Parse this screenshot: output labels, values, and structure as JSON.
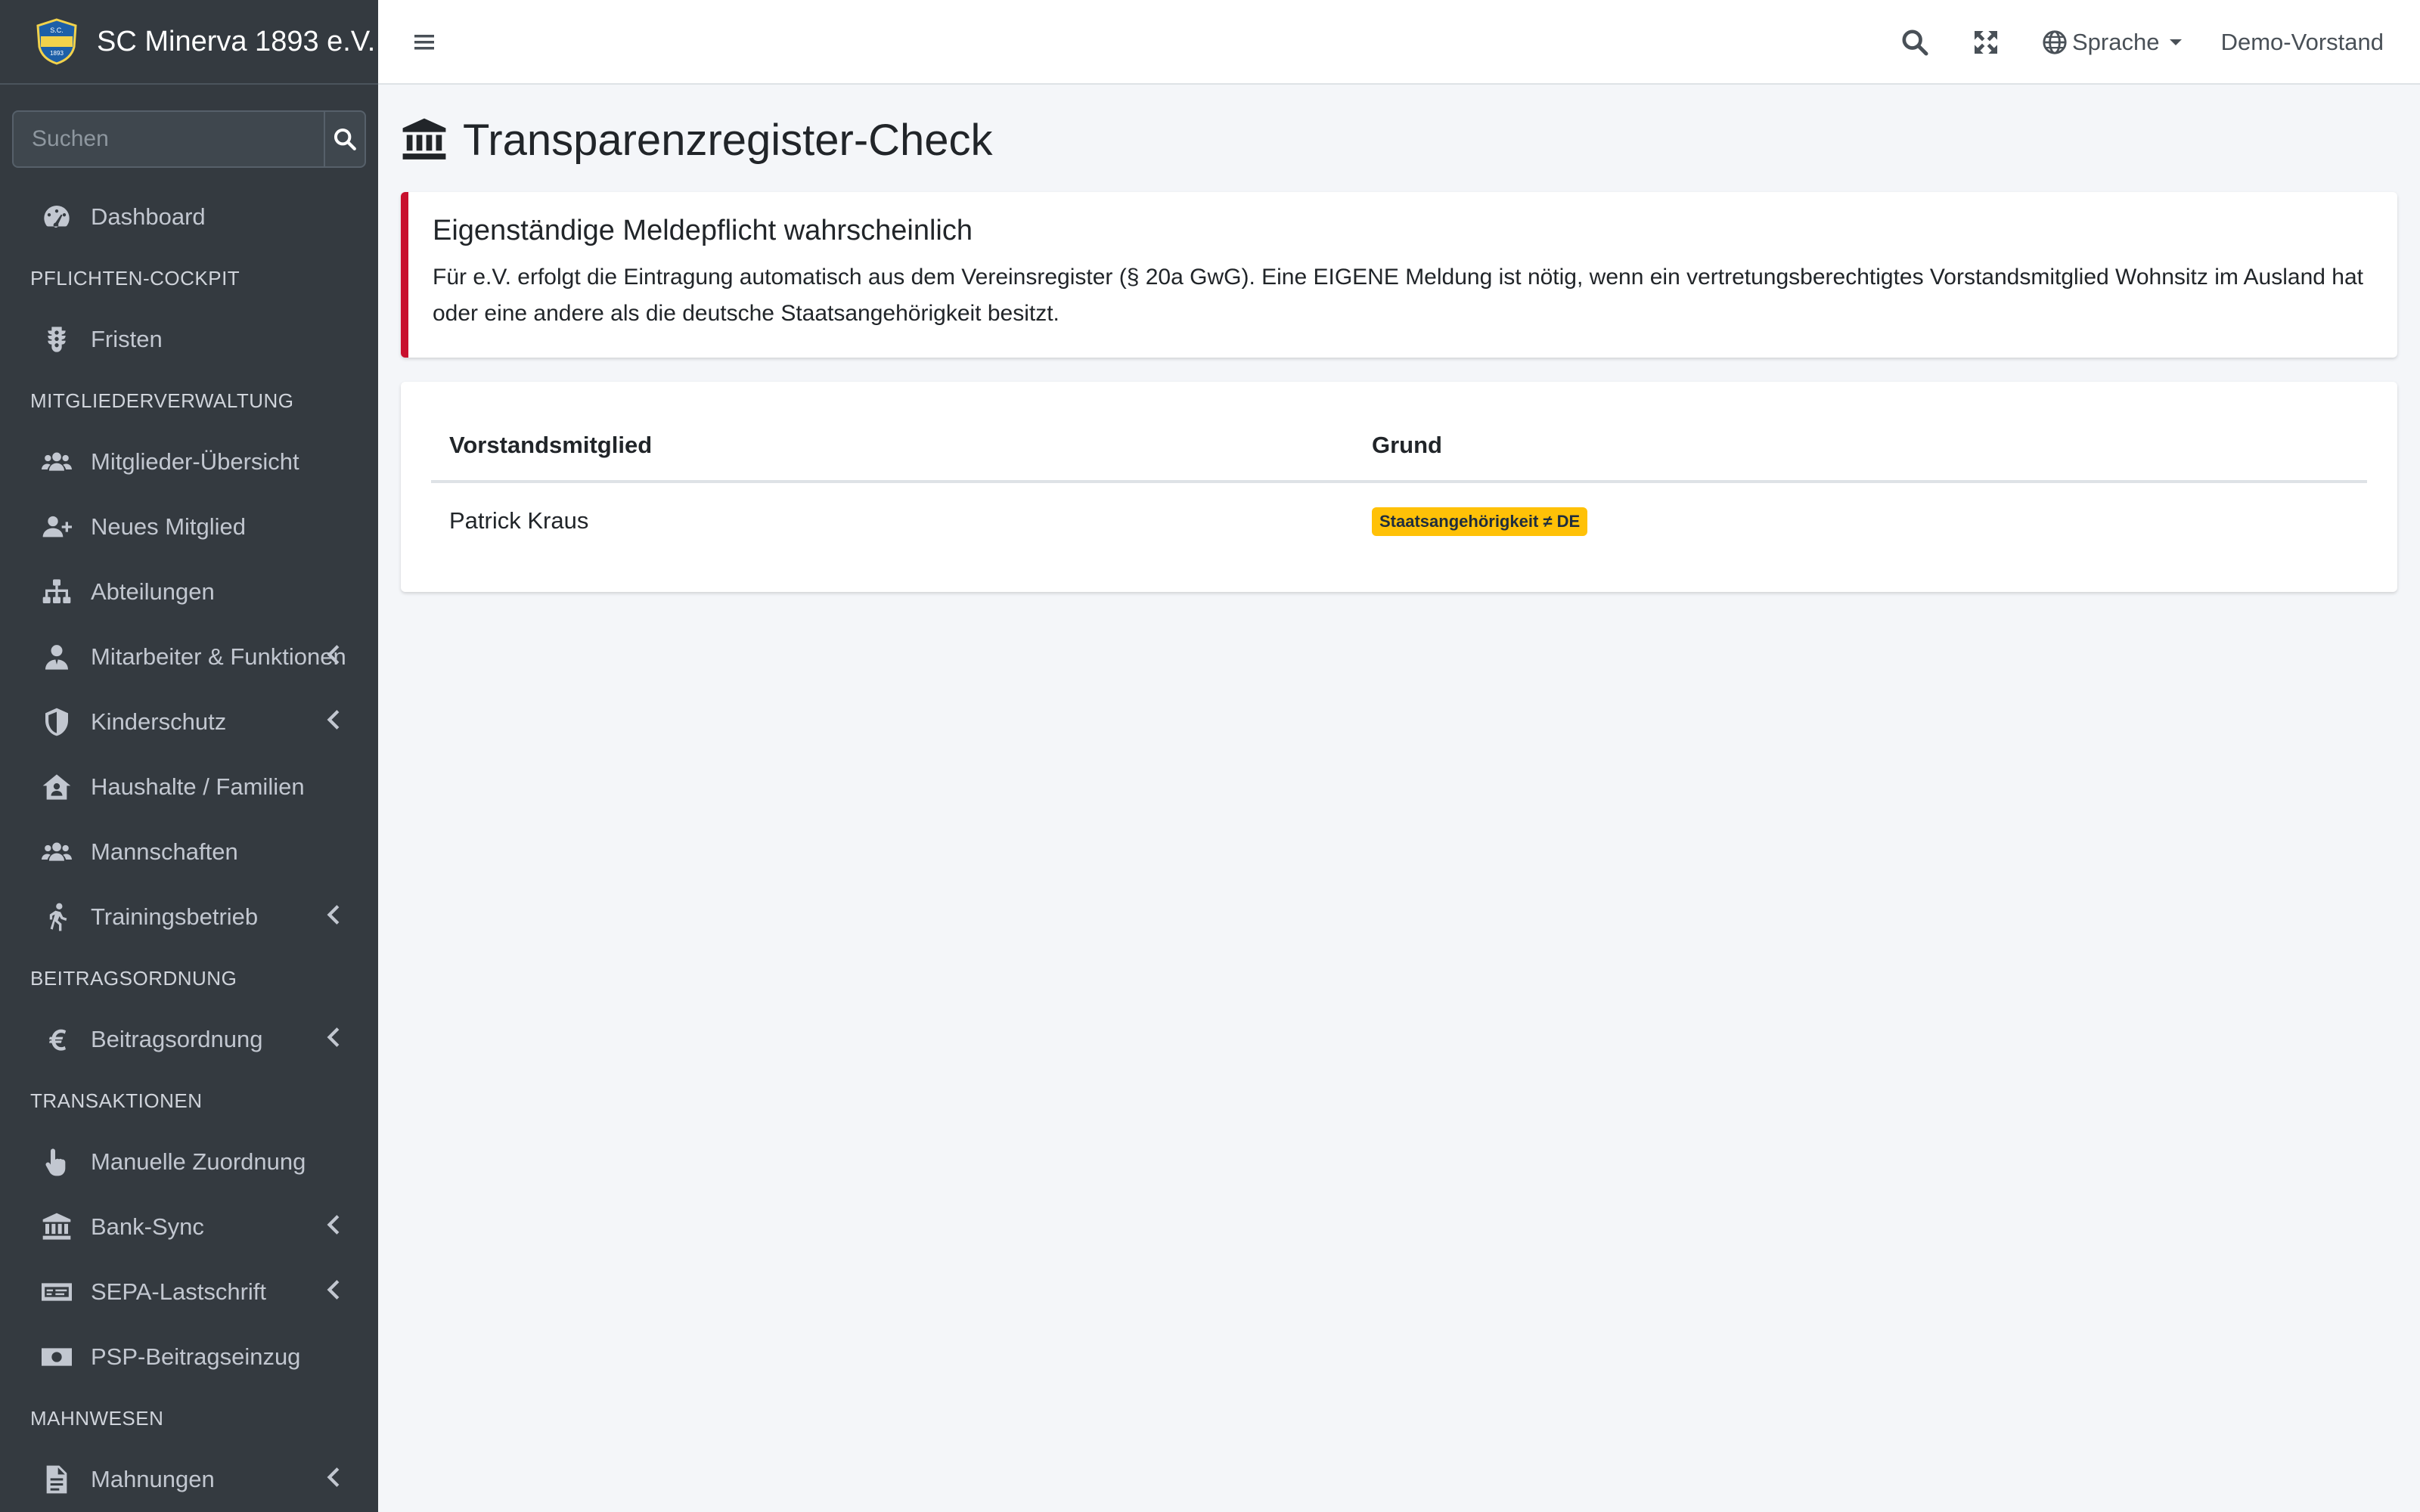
{
  "brand": {
    "name": "SC Minerva 1893 e.V."
  },
  "search": {
    "placeholder": "Suchen"
  },
  "nav": {
    "dashboard": "Dashboard",
    "h1": "PFLICHTEN-COCKPIT",
    "fristen": "Fristen",
    "h2": "MITGLIEDERVERWALTUNG",
    "mitglieder": "Mitglieder-Übersicht",
    "neu": "Neues Mitglied",
    "abteilungen": "Abteilungen",
    "mitarbeiter": "Mitarbeiter & Funktionen",
    "kinderschutz": "Kinderschutz",
    "haushalte": "Haushalte / Familien",
    "mannschaften": "Mannschaften",
    "training": "Trainingsbetrieb",
    "h3": "BEITRAGSORDNUNG",
    "beitrag": "Beitragsordnung",
    "h4": "TRANSAKTIONEN",
    "manuell": "Manuelle Zuordnung",
    "bank": "Bank-Sync",
    "sepa": "SEPA-Lastschrift",
    "psp": "PSP-Beitragseinzug",
    "h5": "MAHNWESEN",
    "mahnungen": "Mahnungen"
  },
  "topbar": {
    "language": "Sprache",
    "user": "Demo-Vorstand"
  },
  "page": {
    "title": "Transparenzregister-Check",
    "callout_title": "Eigenständige Meldepflicht wahrscheinlich",
    "callout_text": "Für e.V. erfolgt die Eintragung automatisch aus dem Vereinsregister (§ 20a GwG). Eine EIGENE Meldung ist nötig, wenn ein vertretungsberechtigtes Vorstandsmitglied Wohnsitz im Ausland hat oder eine andere als die deutsche Staatsangehörigkeit besitzt."
  },
  "table": {
    "headers": [
      "Vorstandsmitglied",
      "Grund"
    ],
    "rows": [
      {
        "name": "Patrick Kraus",
        "reason": "Staatsangehörigkeit ≠ DE"
      }
    ]
  },
  "colors": {
    "sidebar": "#343a40",
    "danger": "#c8102e",
    "warning": "#ffc107"
  }
}
